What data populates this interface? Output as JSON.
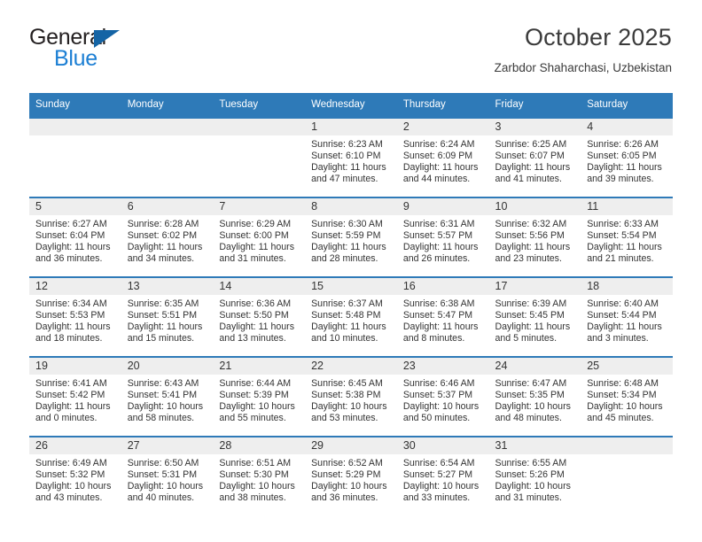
{
  "brand": {
    "name_part1": "General",
    "name_part2": "Blue",
    "logo_icon": "blue-triangle-icon",
    "accent_color": "#1c7fd4",
    "triangle_color": "#1464a5"
  },
  "header": {
    "title": "October 2025",
    "location": "Zarbdor Shaharchasi, Uzbekistan"
  },
  "theme": {
    "header_row_color": "#2e7ab8",
    "daynum_band_color": "#eeeeee",
    "text_color": "#333333"
  },
  "calendar": {
    "weekday_headers": [
      "Sunday",
      "Monday",
      "Tuesday",
      "Wednesday",
      "Thursday",
      "Friday",
      "Saturday"
    ],
    "labels": {
      "sunrise": "Sunrise:",
      "sunset": "Sunset:",
      "daylight": "Daylight:"
    },
    "weeks": [
      [
        {
          "day": "",
          "empty": true
        },
        {
          "day": "",
          "empty": true
        },
        {
          "day": "",
          "empty": true
        },
        {
          "day": "1",
          "sunrise": "Sunrise: 6:23 AM",
          "sunset": "Sunset: 6:10 PM",
          "daylight_line1": "Daylight: 11 hours",
          "daylight_line2": "and 47 minutes."
        },
        {
          "day": "2",
          "sunrise": "Sunrise: 6:24 AM",
          "sunset": "Sunset: 6:09 PM",
          "daylight_line1": "Daylight: 11 hours",
          "daylight_line2": "and 44 minutes."
        },
        {
          "day": "3",
          "sunrise": "Sunrise: 6:25 AM",
          "sunset": "Sunset: 6:07 PM",
          "daylight_line1": "Daylight: 11 hours",
          "daylight_line2": "and 41 minutes."
        },
        {
          "day": "4",
          "sunrise": "Sunrise: 6:26 AM",
          "sunset": "Sunset: 6:05 PM",
          "daylight_line1": "Daylight: 11 hours",
          "daylight_line2": "and 39 minutes."
        }
      ],
      [
        {
          "day": "5",
          "sunrise": "Sunrise: 6:27 AM",
          "sunset": "Sunset: 6:04 PM",
          "daylight_line1": "Daylight: 11 hours",
          "daylight_line2": "and 36 minutes."
        },
        {
          "day": "6",
          "sunrise": "Sunrise: 6:28 AM",
          "sunset": "Sunset: 6:02 PM",
          "daylight_line1": "Daylight: 11 hours",
          "daylight_line2": "and 34 minutes."
        },
        {
          "day": "7",
          "sunrise": "Sunrise: 6:29 AM",
          "sunset": "Sunset: 6:00 PM",
          "daylight_line1": "Daylight: 11 hours",
          "daylight_line2": "and 31 minutes."
        },
        {
          "day": "8",
          "sunrise": "Sunrise: 6:30 AM",
          "sunset": "Sunset: 5:59 PM",
          "daylight_line1": "Daylight: 11 hours",
          "daylight_line2": "and 28 minutes."
        },
        {
          "day": "9",
          "sunrise": "Sunrise: 6:31 AM",
          "sunset": "Sunset: 5:57 PM",
          "daylight_line1": "Daylight: 11 hours",
          "daylight_line2": "and 26 minutes."
        },
        {
          "day": "10",
          "sunrise": "Sunrise: 6:32 AM",
          "sunset": "Sunset: 5:56 PM",
          "daylight_line1": "Daylight: 11 hours",
          "daylight_line2": "and 23 minutes."
        },
        {
          "day": "11",
          "sunrise": "Sunrise: 6:33 AM",
          "sunset": "Sunset: 5:54 PM",
          "daylight_line1": "Daylight: 11 hours",
          "daylight_line2": "and 21 minutes."
        }
      ],
      [
        {
          "day": "12",
          "sunrise": "Sunrise: 6:34 AM",
          "sunset": "Sunset: 5:53 PM",
          "daylight_line1": "Daylight: 11 hours",
          "daylight_line2": "and 18 minutes."
        },
        {
          "day": "13",
          "sunrise": "Sunrise: 6:35 AM",
          "sunset": "Sunset: 5:51 PM",
          "daylight_line1": "Daylight: 11 hours",
          "daylight_line2": "and 15 minutes."
        },
        {
          "day": "14",
          "sunrise": "Sunrise: 6:36 AM",
          "sunset": "Sunset: 5:50 PM",
          "daylight_line1": "Daylight: 11 hours",
          "daylight_line2": "and 13 minutes."
        },
        {
          "day": "15",
          "sunrise": "Sunrise: 6:37 AM",
          "sunset": "Sunset: 5:48 PM",
          "daylight_line1": "Daylight: 11 hours",
          "daylight_line2": "and 10 minutes."
        },
        {
          "day": "16",
          "sunrise": "Sunrise: 6:38 AM",
          "sunset": "Sunset: 5:47 PM",
          "daylight_line1": "Daylight: 11 hours",
          "daylight_line2": "and 8 minutes."
        },
        {
          "day": "17",
          "sunrise": "Sunrise: 6:39 AM",
          "sunset": "Sunset: 5:45 PM",
          "daylight_line1": "Daylight: 11 hours",
          "daylight_line2": "and 5 minutes."
        },
        {
          "day": "18",
          "sunrise": "Sunrise: 6:40 AM",
          "sunset": "Sunset: 5:44 PM",
          "daylight_line1": "Daylight: 11 hours",
          "daylight_line2": "and 3 minutes."
        }
      ],
      [
        {
          "day": "19",
          "sunrise": "Sunrise: 6:41 AM",
          "sunset": "Sunset: 5:42 PM",
          "daylight_line1": "Daylight: 11 hours",
          "daylight_line2": "and 0 minutes."
        },
        {
          "day": "20",
          "sunrise": "Sunrise: 6:43 AM",
          "sunset": "Sunset: 5:41 PM",
          "daylight_line1": "Daylight: 10 hours",
          "daylight_line2": "and 58 minutes."
        },
        {
          "day": "21",
          "sunrise": "Sunrise: 6:44 AM",
          "sunset": "Sunset: 5:39 PM",
          "daylight_line1": "Daylight: 10 hours",
          "daylight_line2": "and 55 minutes."
        },
        {
          "day": "22",
          "sunrise": "Sunrise: 6:45 AM",
          "sunset": "Sunset: 5:38 PM",
          "daylight_line1": "Daylight: 10 hours",
          "daylight_line2": "and 53 minutes."
        },
        {
          "day": "23",
          "sunrise": "Sunrise: 6:46 AM",
          "sunset": "Sunset: 5:37 PM",
          "daylight_line1": "Daylight: 10 hours",
          "daylight_line2": "and 50 minutes."
        },
        {
          "day": "24",
          "sunrise": "Sunrise: 6:47 AM",
          "sunset": "Sunset: 5:35 PM",
          "daylight_line1": "Daylight: 10 hours",
          "daylight_line2": "and 48 minutes."
        },
        {
          "day": "25",
          "sunrise": "Sunrise: 6:48 AM",
          "sunset": "Sunset: 5:34 PM",
          "daylight_line1": "Daylight: 10 hours",
          "daylight_line2": "and 45 minutes."
        }
      ],
      [
        {
          "day": "26",
          "sunrise": "Sunrise: 6:49 AM",
          "sunset": "Sunset: 5:32 PM",
          "daylight_line1": "Daylight: 10 hours",
          "daylight_line2": "and 43 minutes."
        },
        {
          "day": "27",
          "sunrise": "Sunrise: 6:50 AM",
          "sunset": "Sunset: 5:31 PM",
          "daylight_line1": "Daylight: 10 hours",
          "daylight_line2": "and 40 minutes."
        },
        {
          "day": "28",
          "sunrise": "Sunrise: 6:51 AM",
          "sunset": "Sunset: 5:30 PM",
          "daylight_line1": "Daylight: 10 hours",
          "daylight_line2": "and 38 minutes."
        },
        {
          "day": "29",
          "sunrise": "Sunrise: 6:52 AM",
          "sunset": "Sunset: 5:29 PM",
          "daylight_line1": "Daylight: 10 hours",
          "daylight_line2": "and 36 minutes."
        },
        {
          "day": "30",
          "sunrise": "Sunrise: 6:54 AM",
          "sunset": "Sunset: 5:27 PM",
          "daylight_line1": "Daylight: 10 hours",
          "daylight_line2": "and 33 minutes."
        },
        {
          "day": "31",
          "sunrise": "Sunrise: 6:55 AM",
          "sunset": "Sunset: 5:26 PM",
          "daylight_line1": "Daylight: 10 hours",
          "daylight_line2": "and 31 minutes."
        },
        {
          "day": "",
          "empty": true
        }
      ]
    ]
  }
}
